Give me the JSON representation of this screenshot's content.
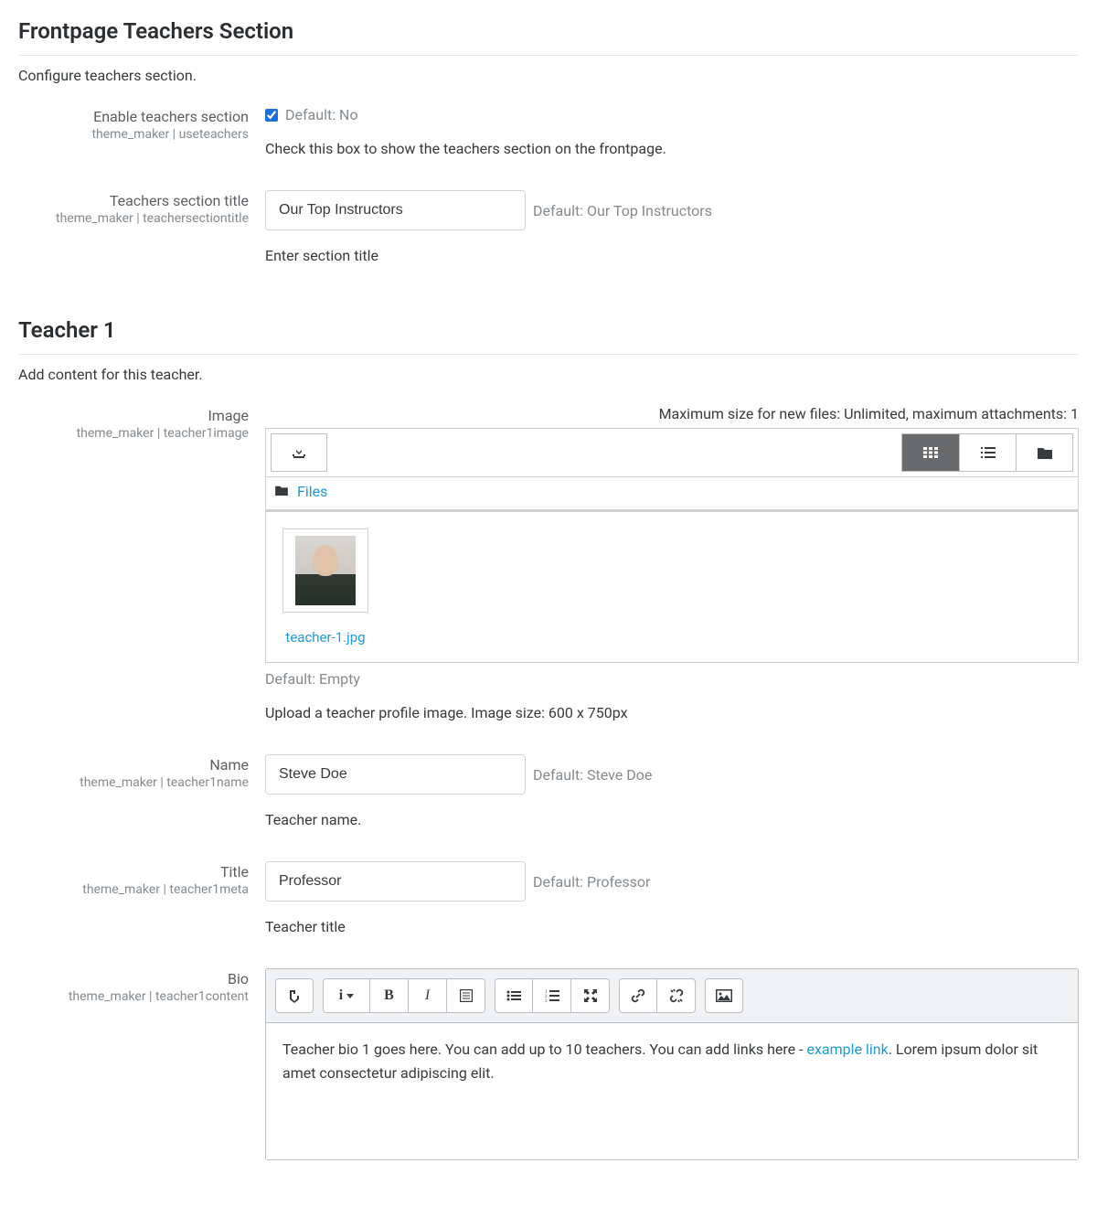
{
  "section1": {
    "heading": "Frontpage Teachers Section",
    "desc": "Configure teachers section.",
    "enable": {
      "label": "Enable teachers section",
      "key": "theme_maker | useteachers",
      "checked": true,
      "default": "Default: No",
      "help": "Check this box to show the teachers section on the frontpage."
    },
    "title": {
      "label": "Teachers section title",
      "key": "theme_maker | teachersectiontitle",
      "value": "Our Top Instructors",
      "default": "Default: Our Top Instructors",
      "help": "Enter section title"
    }
  },
  "section2": {
    "heading": "Teacher 1",
    "desc": "Add content for this teacher.",
    "image": {
      "label": "Image",
      "key": "theme_maker | teacher1image",
      "max_text": "Maximum size for new files: Unlimited, maximum attachments: 1",
      "breadcrumb": "Files",
      "filename": "teacher-1.jpg",
      "default": "Default: Empty",
      "help": "Upload a teacher profile image. Image size: 600 x 750px"
    },
    "name": {
      "label": "Name",
      "key": "theme_maker | teacher1name",
      "value": "Steve Doe",
      "default": "Default: Steve Doe",
      "help": "Teacher name."
    },
    "title": {
      "label": "Title",
      "key": "theme_maker | teacher1meta",
      "value": "Professor",
      "default": "Default: Professor",
      "help": "Teacher title"
    },
    "bio": {
      "label": "Bio",
      "key": "theme_maker | teacher1content",
      "content_pre": "Teacher bio 1 goes here. You can add up to 10 teachers. You can add links here - ",
      "link_text": "example link",
      "content_post": ". Lorem ipsum dolor sit amet consectetur adipiscing elit."
    }
  }
}
